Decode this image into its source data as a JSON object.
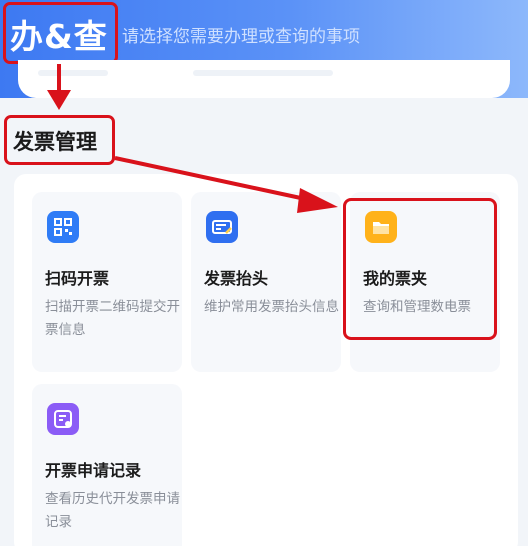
{
  "header": {
    "title": "办&查",
    "subtitle": "请选择您需要办理或查询的事项"
  },
  "section": {
    "title": "发票管理"
  },
  "tiles": [
    {
      "name": "扫码开票",
      "desc": "扫描开票二维码提交开票信息",
      "icon": "qr-code-icon"
    },
    {
      "name": "发票抬头",
      "desc": "维护常用发票抬头信息",
      "icon": "invoice-header-icon"
    },
    {
      "name": "我的票夹",
      "desc": "查询和管理数电票",
      "icon": "folder-icon"
    },
    {
      "name": "开票申请记录",
      "desc": "查看历史代开发票申请记录",
      "icon": "record-icon"
    }
  ],
  "colors": {
    "header": "#3d79f2",
    "annotation": "#d9121b",
    "icon_blue": "#2f7cf6",
    "icon_yellow": "#ffb21a",
    "icon_purple": "#8b5cf6"
  }
}
